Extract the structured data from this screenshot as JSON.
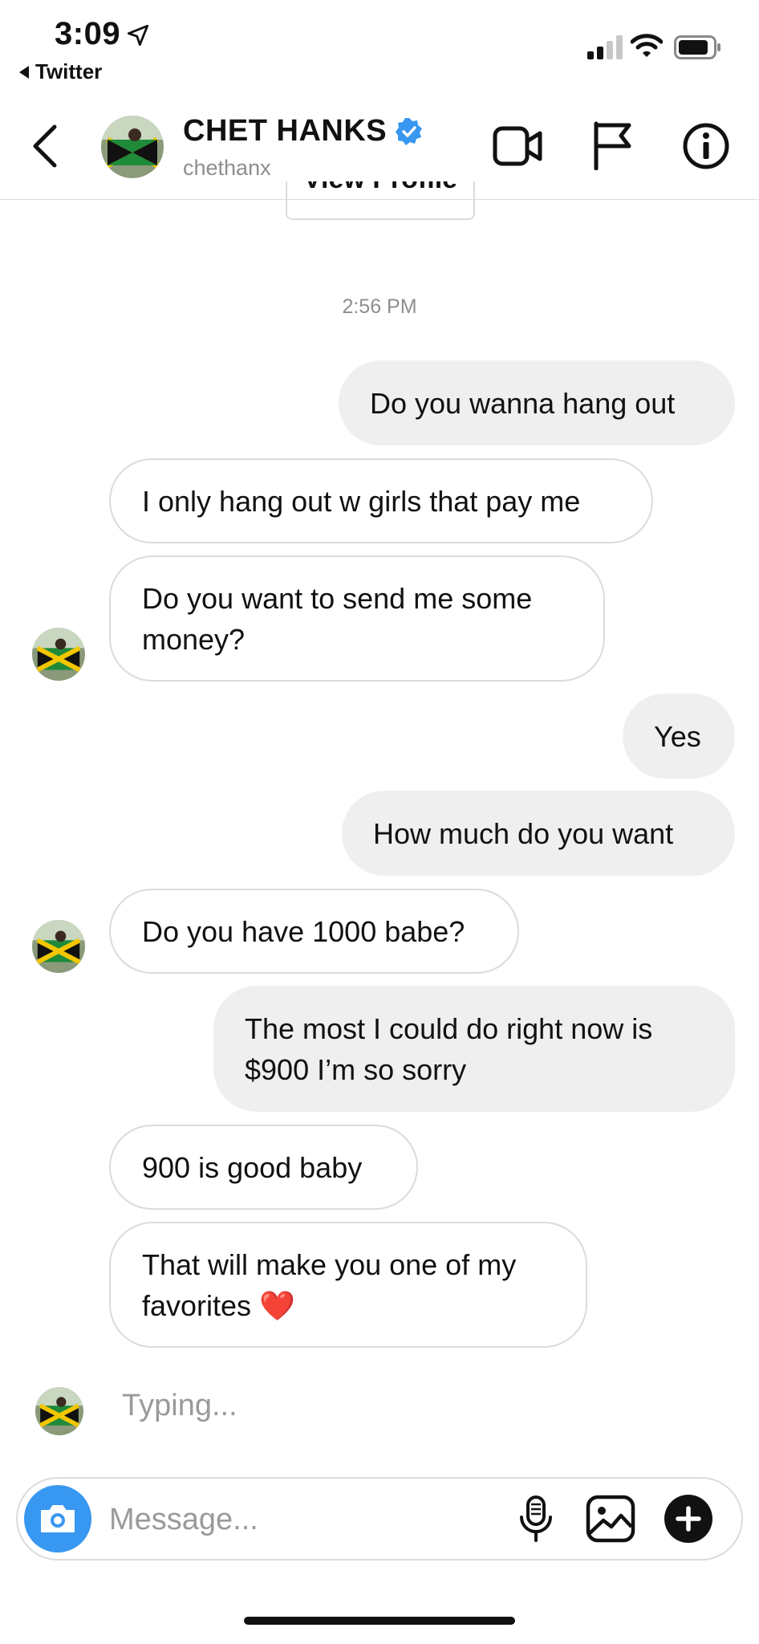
{
  "status_bar": {
    "time": "3:09",
    "back_app": "Twitter"
  },
  "header": {
    "name": "CHET HANKS",
    "username": "chethanx"
  },
  "view_profile_label": "View Profile",
  "timestamp": "2:56 PM",
  "messages": [
    {
      "from": "me",
      "text": "Do you wanna hang out"
    },
    {
      "from": "them",
      "text": "I only hang out w girls that pay me"
    },
    {
      "from": "them",
      "text": "Do you want to send me some money?"
    },
    {
      "from": "me",
      "text": "Yes"
    },
    {
      "from": "me",
      "text": "How much do you want"
    },
    {
      "from": "them",
      "text": "Do you have 1000 babe?"
    },
    {
      "from": "me",
      "text": "The most I could do right now is $900 I’m so sorry"
    },
    {
      "from": "them",
      "text": "900 is good baby"
    },
    {
      "from": "them",
      "text": "That will make you one of my favorites ❤️"
    }
  ],
  "typing_text": "Typing...",
  "composer": {
    "placeholder": "Message..."
  },
  "colors": {
    "accent": "#3897f0",
    "sent_bubble": "#efefef",
    "border": "#dbdbdb",
    "heart": "#e0242f"
  },
  "icons": [
    "location-arrow-icon",
    "signal-icon",
    "wifi-icon",
    "battery-icon",
    "back-chevron-icon",
    "verified-badge-icon",
    "video-call-icon",
    "flag-icon",
    "info-icon",
    "camera-icon",
    "microphone-icon",
    "gallery-icon",
    "plus-icon"
  ]
}
